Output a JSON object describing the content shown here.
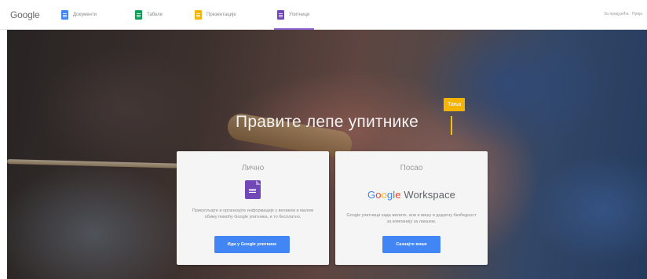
{
  "header": {
    "logo": "Google",
    "nav": [
      {
        "label": "Документи",
        "color": "#4285f4"
      },
      {
        "label": "Табеле",
        "color": "#0f9d58"
      },
      {
        "label": "Презентације",
        "color": "#f4b400"
      },
      {
        "label": "Упитници",
        "color": "#7248b9"
      }
    ],
    "right_link": "За предузећа · Прија"
  },
  "hero": {
    "headline": "Правите лепе упитнике",
    "cursor_tag": "Тања"
  },
  "cards": {
    "personal": {
      "label": "Лично",
      "icon": "forms-icon",
      "description": "Прикупљајте и организујте информације у великом и малом обиму помоћу Google упитника, и то бесплатно.",
      "button": "Иди у Google упитнике"
    },
    "business": {
      "label": "Посао",
      "logo_google": [
        "G",
        "o",
        "o",
        "g",
        "l",
        "e"
      ],
      "logo_product": "Workspace",
      "description": "Google упитници када желите, али и вишу и додатну безбедност за компанију за лакшем.",
      "button": "Сазнајте више"
    }
  },
  "colors": {
    "brand_blue": "#4285f4",
    "forms_purple": "#7248b9",
    "accent_yellow": "#f4b400"
  }
}
